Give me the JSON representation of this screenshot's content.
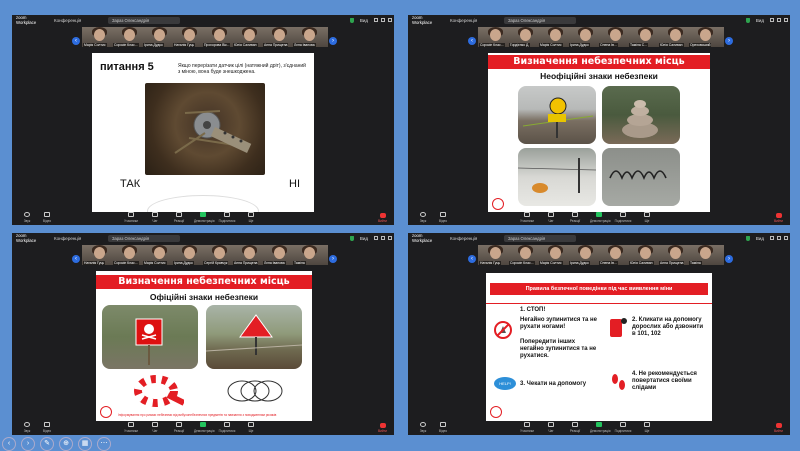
{
  "colors": {
    "desktop": "#5b8fd1",
    "window": "#1d1d1f",
    "accent_red": "#e31e24",
    "share_green": "#23c45e",
    "brand_blue": "#2d6cdf"
  },
  "common": {
    "brand_line1": "zoom",
    "brand_line2": "Workplace",
    "conference": "Конференція",
    "meeting_title": "Зараз Олександрія",
    "view": "Вид",
    "toolbar": [
      "Звук",
      "Відео",
      "Учасники",
      "Чат",
      "Реакції",
      "Демонстрація",
      "Поділитися",
      "Ще"
    ],
    "leave": "Вийти"
  },
  "windows": [
    {
      "thumbs": [
        "Марія Солтис",
        "Сорокін Клас...",
        "Ірина Дудко",
        "Наталія Гуць",
        "Прохорова Вік...",
        "Юлія Саливан",
        "Анна Прищепа",
        "Лєна Іванова"
      ]
    },
    {
      "thumbs": [
        "Сорокін Клас...",
        "Гордієнко Д.",
        "Марія Солтис",
        "Ірина Дудко",
        "Олена Ів...",
        "Таміла С...",
        "Юлія Саливан",
        "Ореховський"
      ]
    },
    {
      "thumbs": [
        "Наталія Гуць",
        "Сорокін Клас...",
        "Марія Солтис",
        "Ірина Дудко",
        "Сергій Кравчук",
        "Анна Прищепа",
        "Лєна Іванова",
        "Таміла"
      ]
    },
    {
      "thumbs": [
        "Наталія Гуць",
        "Сорокін Клас...",
        "Марія Солтис",
        "Ірина Дудко",
        "Олена Ів...",
        "Юлія Саливан",
        "Анна Прищепа",
        "Таміла"
      ]
    }
  ],
  "slide1": {
    "title": "питання 5",
    "question": "Якщо перерізати датчик цілі (натяжний дріт), з'єднаний з міною, вона буде знешкоджена.",
    "yes": "ТАК",
    "no": "НІ"
  },
  "slide2": {
    "banner": "Визначення небезпечних місць",
    "subtitle": "Неофіційні знаки небезпеки"
  },
  "slide3": {
    "banner": "Визначення небезпечних місць",
    "subtitle": "Офіційні знаки небезпеки",
    "footer": "Інформування про ризики небезпеки від вибухонебезпечних предметів та навчання з поводженням ризиків"
  },
  "slide4": {
    "banner": "Правила безпечної поведінки під час виявлення міни",
    "r1_head": "1. СТОП!",
    "r1_a": "Негайно зупинитися та не рухати ногами!",
    "r1_b": "Попередити інших негайно зупинитися та не рухатися.",
    "r2": "2. Кликати на допомогу дорослих або дзвонити в 101, 102",
    "r3": "3. Чекати на допомогу",
    "r4": "4. Не рекомендується повертатися своїми слідами",
    "help": "HELP!"
  }
}
